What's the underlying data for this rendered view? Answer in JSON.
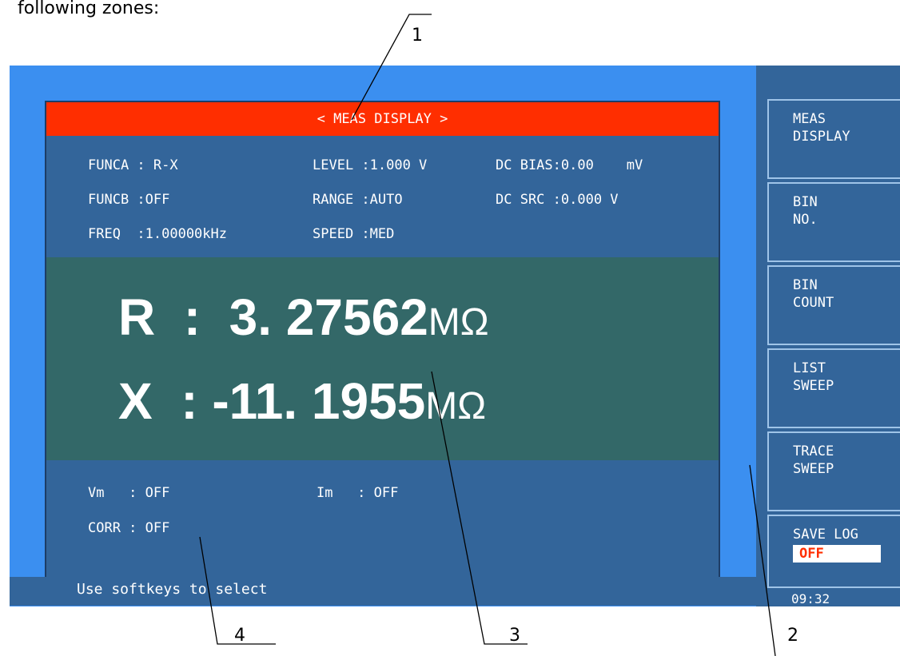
{
  "intro_text": "following zones:",
  "callouts": [
    "1",
    "2",
    "3",
    "4"
  ],
  "screen": {
    "title": "< MEAS DISPLAY >",
    "params": {
      "funca": "FUNCA : R-X",
      "funcb": "FUNCB :OFF",
      "freq": "FREQ  :1.00000kHz",
      "level": "LEVEL :1.000 V",
      "range": "RANGE :AUTO",
      "speed": "SPEED :MED",
      "dc_bias": "DC BIAS:0.00    mV",
      "dc_src": "DC SRC :0.000 V"
    },
    "readings": {
      "primary_label": "R  :  3. 27562",
      "primary_unit": "MΩ",
      "secondary_label": "X  : -11. 1955",
      "secondary_unit": "MΩ"
    },
    "monitor": {
      "vm": "Vm   : OFF",
      "im": "Im   : OFF",
      "corr": "CORR : OFF"
    },
    "status": "Use softkeys to select"
  },
  "softkeys": [
    {
      "line1": "MEAS",
      "line2": "DISPLAY"
    },
    {
      "line1": "BIN",
      "line2": "NO."
    },
    {
      "line1": "BIN",
      "line2": "COUNT"
    },
    {
      "line1": "LIST",
      "line2": "SWEEP"
    },
    {
      "line1": "TRACE",
      "line2": "SWEEP"
    },
    {
      "line1": "SAVE LOG",
      "state": "OFF"
    }
  ],
  "clock": "09:32",
  "colors": {
    "frame": "#3b8ff0",
    "panel": "#33659a",
    "title_bar": "#ff2e00",
    "reading_area": "#336868"
  }
}
